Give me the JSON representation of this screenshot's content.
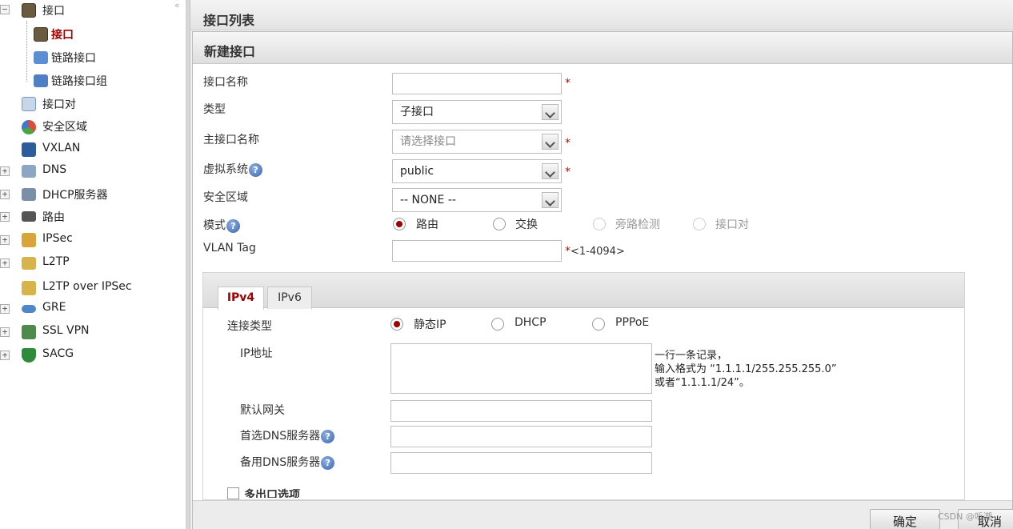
{
  "sidebar": {
    "items": [
      {
        "label": "接口",
        "expander": "−"
      },
      {
        "label": "接口"
      },
      {
        "label": "链路接口"
      },
      {
        "label": "链路接口组"
      },
      {
        "label": "接口对"
      },
      {
        "label": "安全区域"
      },
      {
        "label": "VXLAN"
      },
      {
        "label": "DNS",
        "expander": "+"
      },
      {
        "label": "DHCP服务器",
        "expander": "+"
      },
      {
        "label": "路由",
        "expander": "+"
      },
      {
        "label": "IPSec",
        "expander": "+"
      },
      {
        "label": "L2TP",
        "expander": "+"
      },
      {
        "label": "L2TP over IPSec"
      },
      {
        "label": "GRE",
        "expander": "+"
      },
      {
        "label": "SSL VPN",
        "expander": "+"
      },
      {
        "label": "SACG",
        "expander": "+"
      }
    ],
    "collapse_glyph": "«"
  },
  "list_header": {
    "title": "接口列表"
  },
  "dialog": {
    "title": "新建接口",
    "fields": {
      "name": {
        "label": "接口名称",
        "value": "",
        "required": "*"
      },
      "type": {
        "label": "类型",
        "value": "子接口"
      },
      "parent": {
        "label": "主接口名称",
        "value": "请选择接口",
        "required": "*"
      },
      "vsys": {
        "label": "虚拟系统",
        "value": "public",
        "required": "*"
      },
      "zone": {
        "label": "安全区域",
        "value": "-- NONE --"
      },
      "mode": {
        "label": "模式",
        "options": [
          "路由",
          "交换",
          "旁路检测",
          "接口对"
        ]
      },
      "vlan": {
        "label": "VLAN Tag",
        "value": "",
        "hint": "<1-4094>",
        "required": "*"
      }
    },
    "tabs": [
      "IPv4",
      "IPv6"
    ],
    "ipv4": {
      "conn_type": {
        "label": "连接类型",
        "options": [
          "静态IP",
          "DHCP",
          "PPPoE"
        ]
      },
      "ip": {
        "label": "IP地址",
        "value": "",
        "note1": "一行一条记录，",
        "note2": "输入格式为 “1.1.1.1/255.255.255.0”",
        "note3": "或者“1.1.1.1/24”。"
      },
      "gateway": {
        "label": "默认网关",
        "value": ""
      },
      "dns1": {
        "label": "首选DNS服务器",
        "value": ""
      },
      "dns2": {
        "label": "备用DNS服务器",
        "value": ""
      },
      "multi_exit": {
        "label": "多出口选项"
      }
    },
    "buttons": {
      "ok": "确定",
      "cancel": "取消"
    },
    "help_glyph": "?"
  },
  "colors": {
    "accent": "#a30000",
    "required": "#cc0000"
  },
  "watermark": "CSDN @听潮"
}
